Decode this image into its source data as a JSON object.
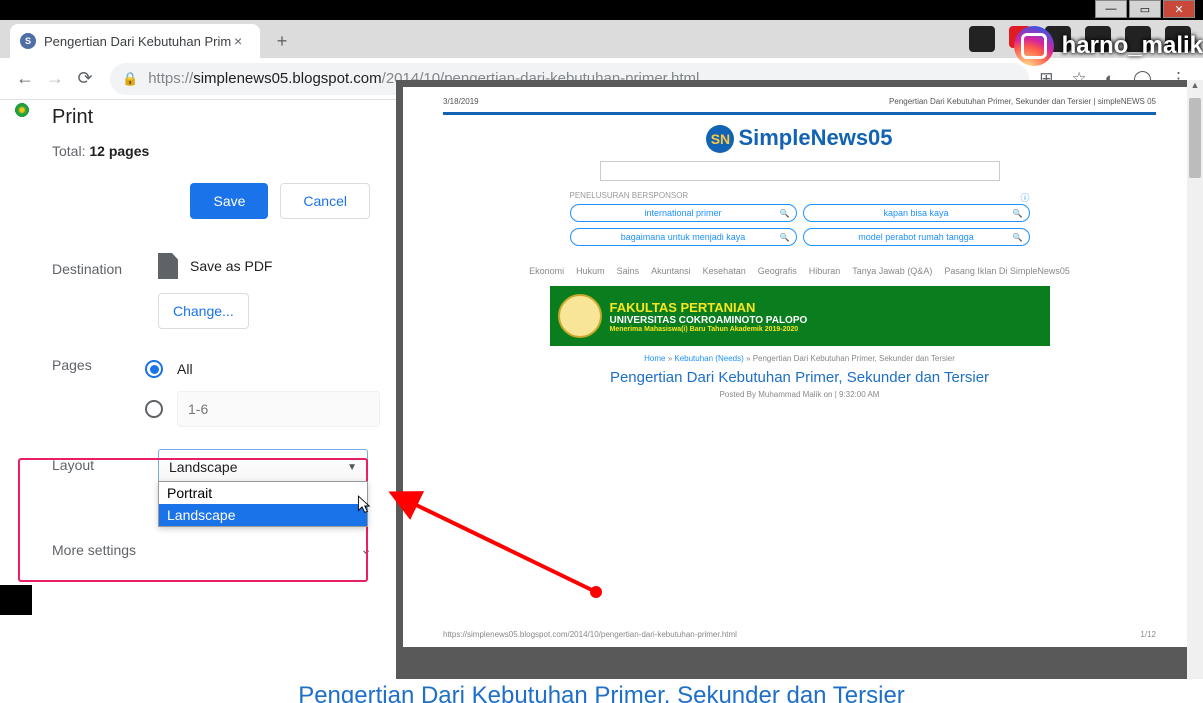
{
  "window": {
    "tab_title": "Pengertian Dari Kebutuhan Prim",
    "url_scheme": "https://",
    "url_host": "simplenews05.blogspot.com",
    "url_path": "/2014/10/pengertian-dari-kebutuhan-primer.html"
  },
  "watermark": {
    "text": "harno_malik"
  },
  "print": {
    "title": "Print",
    "total_prefix": "Total: ",
    "total_value": "12 pages",
    "save_label": "Save",
    "cancel_label": "Cancel",
    "destination_label": "Destination",
    "destination_value": "Save as PDF",
    "change_label": "Change...",
    "pages_label": "Pages",
    "pages_all": "All",
    "pages_range_placeholder": "1-6",
    "layout_label": "Layout",
    "layout_value": "Landscape",
    "layout_options": {
      "portrait": "Portrait",
      "landscape": "Landscape"
    },
    "more_label": "More settings"
  },
  "preview": {
    "date": "3/18/2019",
    "header_title": "Pengertian Dari Kebutuhan Primer, Sekunder dan Tersier | simpleNEWS 05",
    "logo_text": "SimpleNews05",
    "sponsor_label": "PENELUSURAN BERSPONSOR",
    "pills": [
      "international primer",
      "kapan bisa kaya",
      "bagaimana untuk menjadi kaya",
      "model perabot rumah tangga"
    ],
    "nav": [
      "Ekonomi",
      "Hukum",
      "Sains",
      "Akuntansi",
      "Kesehatan",
      "Geografis",
      "Hiburan",
      "Tanya Jawab (Q&A)",
      "Pasang Iklan Di SimpleNews05"
    ],
    "banner": {
      "line1": "FAKULTAS PERTANIAN",
      "line2": "UNIVERSITAS COKROAMINOTO PALOPO",
      "line3": "Menerima Mahasiswa(i) Baru Tahun Akademik 2019-2020"
    },
    "breadcrumb": {
      "home": "Home",
      "cat": "Kebutuhan (Needs)",
      "current": "Pengertian Dari Kebutuhan Primer, Sekunder dan Tersier"
    },
    "article_title": "Pengertian Dari Kebutuhan Primer, Sekunder dan Tersier",
    "meta": "Posted By Muhammad Malik on | 9:32:00 AM",
    "footer_url": "https://simplenews05.blogspot.com/2014/10/pengertian-dari-kebutuhan-primer.html",
    "page_indicator": "1/12"
  },
  "bottom_peek": "Pengertian Dari Kebutuhan Primer, Sekunder dan Tersier"
}
